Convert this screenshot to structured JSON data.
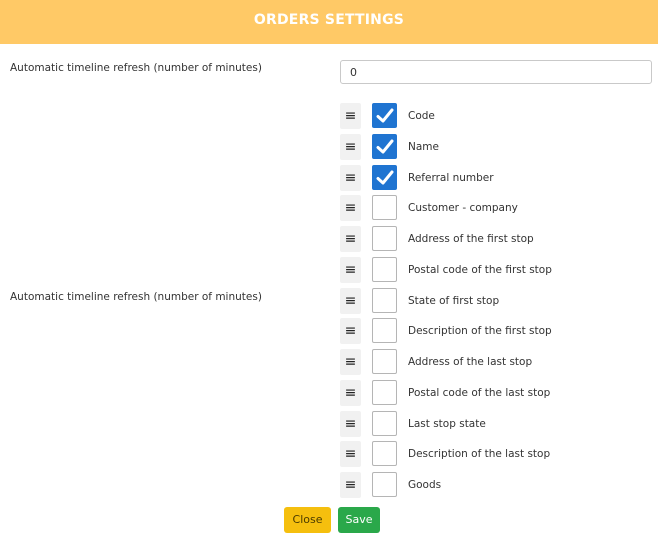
{
  "header": {
    "title": "ORDERS SETTINGS"
  },
  "refresh": {
    "label_top": "Automatic timeline refresh (number of minutes)",
    "value": "0",
    "label_side": "Automatic timeline refresh (number of minutes)"
  },
  "columns": [
    {
      "label": "Code",
      "checked": true
    },
    {
      "label": "Name",
      "checked": true
    },
    {
      "label": "Referral number",
      "checked": true
    },
    {
      "label": "Customer - company",
      "checked": false
    },
    {
      "label": "Address of the first stop",
      "checked": false
    },
    {
      "label": "Postal code of the first stop",
      "checked": false
    },
    {
      "label": "State of first stop",
      "checked": false
    },
    {
      "label": "Description of the first stop",
      "checked": false
    },
    {
      "label": "Address of the last stop",
      "checked": false
    },
    {
      "label": "Postal code of the last stop",
      "checked": false
    },
    {
      "label": "Last stop state",
      "checked": false
    },
    {
      "label": "Description of the last stop",
      "checked": false
    },
    {
      "label": "Goods",
      "checked": false
    }
  ],
  "icons": {
    "drag": "drag-handle-icon",
    "check": "checkmark-icon"
  },
  "buttons": {
    "close_label": "Close",
    "save_label": "Save"
  },
  "colors": {
    "header": "#ffc966",
    "checked": "#1f74d1",
    "close": "#f5bf0e",
    "save": "#2aa84a"
  }
}
